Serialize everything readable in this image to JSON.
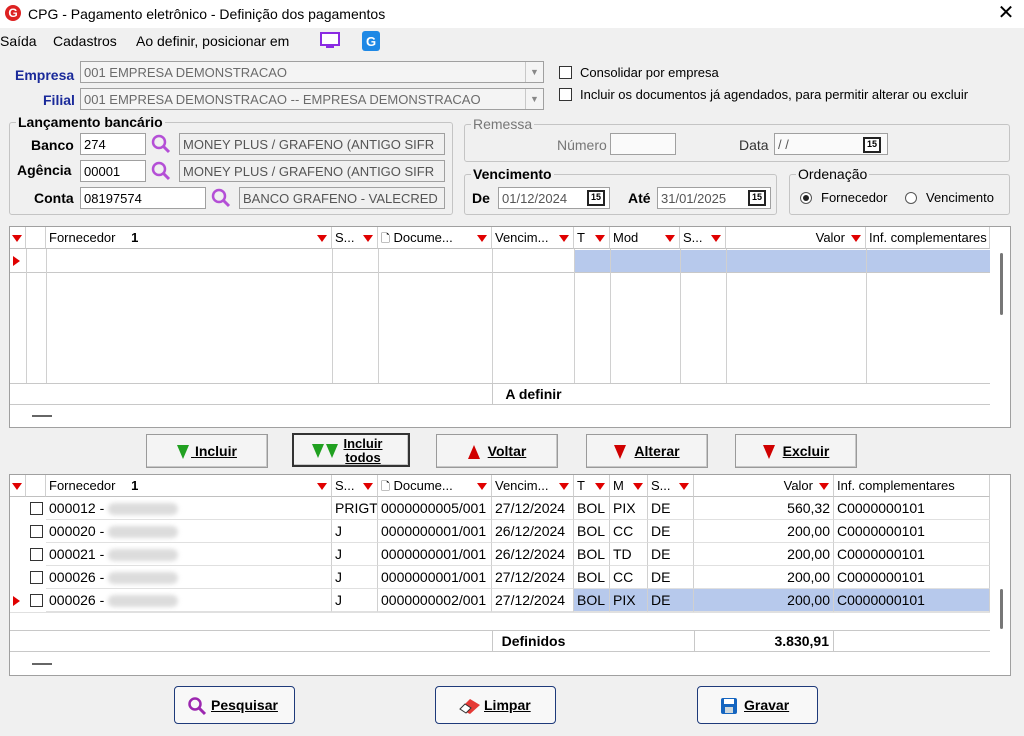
{
  "window": {
    "title": "CPG - Pagamento eletrônico - Definição dos pagamentos",
    "close": "✕"
  },
  "menu": [
    "Saída",
    "Cadastros",
    "Ao definir, posicionar em"
  ],
  "form": {
    "empresa_label": "Empresa",
    "empresa_value": "001 EMPRESA DEMONSTRACAO",
    "filial_label": "Filial",
    "filial_value": "001 EMPRESA DEMONSTRACAO -- EMPRESA DEMONSTRACAO",
    "consolidar_label": "Consolidar por empresa",
    "incluir_agendados_label": "Incluir os documentos já agendados, para permitir alterar ou excluir"
  },
  "lancamento": {
    "title": "Lançamento bancário",
    "banco_label": "Banco",
    "banco_value": "274",
    "banco_desc": "MONEY PLUS / GRAFENO (ANTIGO SIFR",
    "agencia_label": "Agência",
    "agencia_value": "00001",
    "agencia_desc": "MONEY PLUS / GRAFENO (ANTIGO SIFR",
    "conta_label": "Conta",
    "conta_value": "08197574",
    "conta_desc": "BANCO GRAFENO - VALECRED"
  },
  "remessa": {
    "title": "Remessa",
    "numero_label": "Número",
    "numero_value": "",
    "data_label": "Data",
    "data_value": "/ /"
  },
  "vencimento": {
    "title": "Vencimento",
    "de_label": "De",
    "de_value": "01/12/2024",
    "ate_label": "Até",
    "ate_value": "31/01/2025"
  },
  "ordenacao": {
    "title": "Ordenação",
    "opt1": "Fornecedor",
    "opt2": "Vencimento",
    "selected": "Fornecedor"
  },
  "calendar_icon_text": "15",
  "grid1": {
    "headers": [
      "Fornecedor",
      "S...",
      "Docume...",
      "Vencim...",
      "T",
      "Mod",
      "S...",
      "Valor",
      "Inf. complementares"
    ],
    "sort_marker": "1",
    "footer": "A definir"
  },
  "actions": {
    "incluir": "Incluir",
    "incluir_todos": "Incluir todos",
    "voltar": "Voltar",
    "alterar": "Alterar",
    "excluir": "Excluir"
  },
  "grid2": {
    "headers": [
      "Fornecedor",
      "S...",
      "Docume...",
      "Vencim...",
      "T",
      "M",
      "S...",
      "Valor",
      "Inf. complementares"
    ],
    "sort_marker": "1",
    "rows": [
      {
        "fornecedor": "000012 -",
        "s": "PRIGT",
        "doc": "0000000005/001",
        "venc": "27/12/2024",
        "t": "BOL",
        "m": "PIX",
        "s2": "DE",
        "valor": "560,32",
        "inf": "C0000000101"
      },
      {
        "fornecedor": "000020 -",
        "s": "J",
        "doc": "0000000001/001",
        "venc": "26/12/2024",
        "t": "BOL",
        "m": "CC",
        "s2": "DE",
        "valor": "200,00",
        "inf": "C0000000101"
      },
      {
        "fornecedor": "000021 -",
        "s": "J",
        "doc": "0000000001/001",
        "venc": "26/12/2024",
        "t": "BOL",
        "m": "TD",
        "s2": "DE",
        "valor": "200,00",
        "inf": "C0000000101"
      },
      {
        "fornecedor": "000026 -",
        "s": "J",
        "doc": "0000000001/001",
        "venc": "27/12/2024",
        "t": "BOL",
        "m": "CC",
        "s2": "DE",
        "valor": "200,00",
        "inf": "C0000000101"
      },
      {
        "fornecedor": "000026 -",
        "s": "J",
        "doc": "0000000002/001",
        "venc": "27/12/2024",
        "t": "BOL",
        "m": "PIX",
        "s2": "DE",
        "valor": "200,00",
        "inf": "C0000000101"
      }
    ],
    "footer_label": "Definidos",
    "footer_total": "3.830,91"
  },
  "bottom": {
    "pesquisar": "Pesquisar",
    "limpar": "Limpar",
    "gravar": "Gravar"
  },
  "colors": {
    "label_blue": "#1a2a9a",
    "filter_red": "#e00000",
    "selected_row": "#b7c9ec",
    "button_border": "#1e3a7a"
  }
}
